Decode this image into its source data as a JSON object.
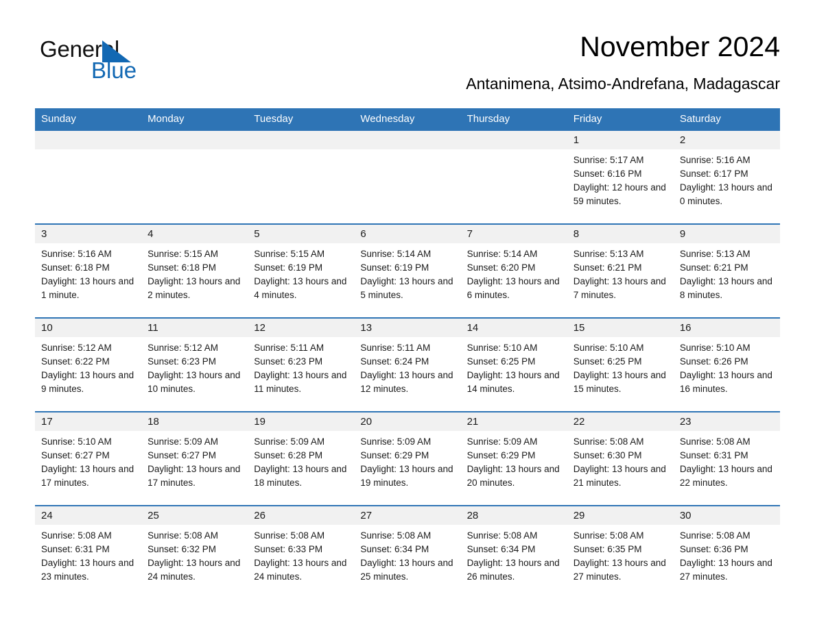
{
  "logo": {
    "word_one": "General",
    "word_two": "Blue",
    "triangle_color": "#1268b3",
    "icon": "triangle-logo-icon"
  },
  "header": {
    "month_title": "November 2024",
    "location": "Antanimena, Atsimo-Andrefana, Madagascar"
  },
  "colors": {
    "header_blue": "#2e74b5",
    "daynum_band": "#f1f1f1",
    "text": "#1a1a1a",
    "logo_blue": "#1268b3"
  },
  "calendar": {
    "weekday_headers": [
      "Sunday",
      "Monday",
      "Tuesday",
      "Wednesday",
      "Thursday",
      "Friday",
      "Saturday"
    ],
    "weeks": [
      [
        {
          "day": "",
          "empty": true
        },
        {
          "day": "",
          "empty": true
        },
        {
          "day": "",
          "empty": true
        },
        {
          "day": "",
          "empty": true
        },
        {
          "day": "",
          "empty": true
        },
        {
          "day": "1",
          "sunrise": "Sunrise: 5:17 AM",
          "sunset": "Sunset: 6:16 PM",
          "daylight": "Daylight: 12 hours and 59 minutes."
        },
        {
          "day": "2",
          "sunrise": "Sunrise: 5:16 AM",
          "sunset": "Sunset: 6:17 PM",
          "daylight": "Daylight: 13 hours and 0 minutes."
        }
      ],
      [
        {
          "day": "3",
          "sunrise": "Sunrise: 5:16 AM",
          "sunset": "Sunset: 6:18 PM",
          "daylight": "Daylight: 13 hours and 1 minute."
        },
        {
          "day": "4",
          "sunrise": "Sunrise: 5:15 AM",
          "sunset": "Sunset: 6:18 PM",
          "daylight": "Daylight: 13 hours and 2 minutes."
        },
        {
          "day": "5",
          "sunrise": "Sunrise: 5:15 AM",
          "sunset": "Sunset: 6:19 PM",
          "daylight": "Daylight: 13 hours and 4 minutes."
        },
        {
          "day": "6",
          "sunrise": "Sunrise: 5:14 AM",
          "sunset": "Sunset: 6:19 PM",
          "daylight": "Daylight: 13 hours and 5 minutes."
        },
        {
          "day": "7",
          "sunrise": "Sunrise: 5:14 AM",
          "sunset": "Sunset: 6:20 PM",
          "daylight": "Daylight: 13 hours and 6 minutes."
        },
        {
          "day": "8",
          "sunrise": "Sunrise: 5:13 AM",
          "sunset": "Sunset: 6:21 PM",
          "daylight": "Daylight: 13 hours and 7 minutes."
        },
        {
          "day": "9",
          "sunrise": "Sunrise: 5:13 AM",
          "sunset": "Sunset: 6:21 PM",
          "daylight": "Daylight: 13 hours and 8 minutes."
        }
      ],
      [
        {
          "day": "10",
          "sunrise": "Sunrise: 5:12 AM",
          "sunset": "Sunset: 6:22 PM",
          "daylight": "Daylight: 13 hours and 9 minutes."
        },
        {
          "day": "11",
          "sunrise": "Sunrise: 5:12 AM",
          "sunset": "Sunset: 6:23 PM",
          "daylight": "Daylight: 13 hours and 10 minutes."
        },
        {
          "day": "12",
          "sunrise": "Sunrise: 5:11 AM",
          "sunset": "Sunset: 6:23 PM",
          "daylight": "Daylight: 13 hours and 11 minutes."
        },
        {
          "day": "13",
          "sunrise": "Sunrise: 5:11 AM",
          "sunset": "Sunset: 6:24 PM",
          "daylight": "Daylight: 13 hours and 12 minutes."
        },
        {
          "day": "14",
          "sunrise": "Sunrise: 5:10 AM",
          "sunset": "Sunset: 6:25 PM",
          "daylight": "Daylight: 13 hours and 14 minutes."
        },
        {
          "day": "15",
          "sunrise": "Sunrise: 5:10 AM",
          "sunset": "Sunset: 6:25 PM",
          "daylight": "Daylight: 13 hours and 15 minutes."
        },
        {
          "day": "16",
          "sunrise": "Sunrise: 5:10 AM",
          "sunset": "Sunset: 6:26 PM",
          "daylight": "Daylight: 13 hours and 16 minutes."
        }
      ],
      [
        {
          "day": "17",
          "sunrise": "Sunrise: 5:10 AM",
          "sunset": "Sunset: 6:27 PM",
          "daylight": "Daylight: 13 hours and 17 minutes."
        },
        {
          "day": "18",
          "sunrise": "Sunrise: 5:09 AM",
          "sunset": "Sunset: 6:27 PM",
          "daylight": "Daylight: 13 hours and 17 minutes."
        },
        {
          "day": "19",
          "sunrise": "Sunrise: 5:09 AM",
          "sunset": "Sunset: 6:28 PM",
          "daylight": "Daylight: 13 hours and 18 minutes."
        },
        {
          "day": "20",
          "sunrise": "Sunrise: 5:09 AM",
          "sunset": "Sunset: 6:29 PM",
          "daylight": "Daylight: 13 hours and 19 minutes."
        },
        {
          "day": "21",
          "sunrise": "Sunrise: 5:09 AM",
          "sunset": "Sunset: 6:29 PM",
          "daylight": "Daylight: 13 hours and 20 minutes."
        },
        {
          "day": "22",
          "sunrise": "Sunrise: 5:08 AM",
          "sunset": "Sunset: 6:30 PM",
          "daylight": "Daylight: 13 hours and 21 minutes."
        },
        {
          "day": "23",
          "sunrise": "Sunrise: 5:08 AM",
          "sunset": "Sunset: 6:31 PM",
          "daylight": "Daylight: 13 hours and 22 minutes."
        }
      ],
      [
        {
          "day": "24",
          "sunrise": "Sunrise: 5:08 AM",
          "sunset": "Sunset: 6:31 PM",
          "daylight": "Daylight: 13 hours and 23 minutes."
        },
        {
          "day": "25",
          "sunrise": "Sunrise: 5:08 AM",
          "sunset": "Sunset: 6:32 PM",
          "daylight": "Daylight: 13 hours and 24 minutes."
        },
        {
          "day": "26",
          "sunrise": "Sunrise: 5:08 AM",
          "sunset": "Sunset: 6:33 PM",
          "daylight": "Daylight: 13 hours and 24 minutes."
        },
        {
          "day": "27",
          "sunrise": "Sunrise: 5:08 AM",
          "sunset": "Sunset: 6:34 PM",
          "daylight": "Daylight: 13 hours and 25 minutes."
        },
        {
          "day": "28",
          "sunrise": "Sunrise: 5:08 AM",
          "sunset": "Sunset: 6:34 PM",
          "daylight": "Daylight: 13 hours and 26 minutes."
        },
        {
          "day": "29",
          "sunrise": "Sunrise: 5:08 AM",
          "sunset": "Sunset: 6:35 PM",
          "daylight": "Daylight: 13 hours and 27 minutes."
        },
        {
          "day": "30",
          "sunrise": "Sunrise: 5:08 AM",
          "sunset": "Sunset: 6:36 PM",
          "daylight": "Daylight: 13 hours and 27 minutes."
        }
      ]
    ]
  }
}
